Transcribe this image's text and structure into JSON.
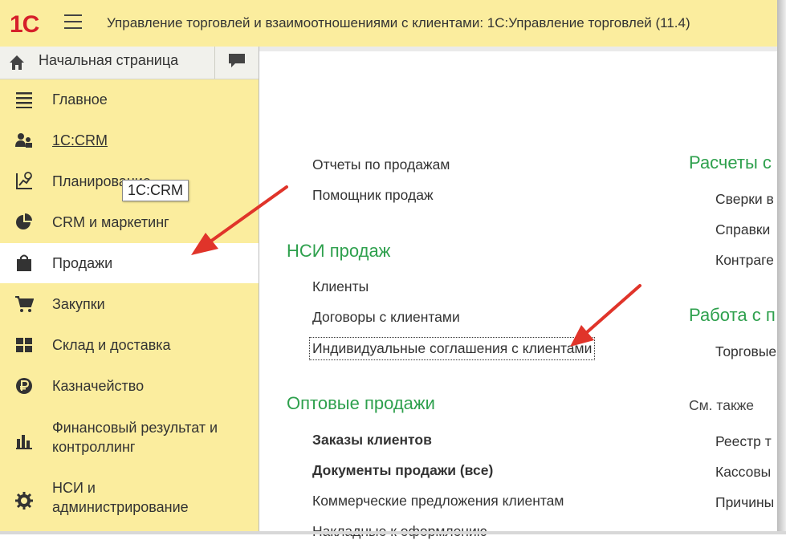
{
  "titlebar": {
    "logo": "1С",
    "title": "Управление торговлей и взаимоотношениями с клиентами: 1С:Управление торговлей (11.4)"
  },
  "home": {
    "label": "Начальная страница"
  },
  "sidebar": {
    "items": [
      {
        "label": "Главное",
        "icon": "list-icon"
      },
      {
        "label": "1C:CRM",
        "icon": "users-icon"
      },
      {
        "label": "Планирование",
        "icon": "planning-icon"
      },
      {
        "label": "CRM и маркетинг",
        "icon": "pie-chart-icon"
      },
      {
        "label": "Продажи",
        "icon": "shopping-bag-icon"
      },
      {
        "label": "Закупки",
        "icon": "cart-icon"
      },
      {
        "label": "Склад и доставка",
        "icon": "warehouse-grid-icon"
      },
      {
        "label": "Казначейство",
        "icon": "ruble-icon"
      },
      {
        "label": "Финансовый результат и\nконтроллинг",
        "line1": "Финансовый результат и",
        "line2": "контроллинг",
        "icon": "bar-chart-icon"
      },
      {
        "label": "НСИ и\nадминистрирование",
        "line1": "НСИ и",
        "line2": "администрирование",
        "icon": "gear-icon"
      }
    ],
    "tooltip": "1C:CRM"
  },
  "main": {
    "col1": {
      "top_links": [
        "Отчеты по продажам",
        "Помощник продаж"
      ],
      "sections": [
        {
          "title": "НСИ продаж",
          "links": [
            "Клиенты",
            "Договоры с клиентами",
            "Индивидуальные соглашения с клиентами"
          ]
        },
        {
          "title": "Оптовые продажи",
          "links": [
            "Заказы клиентов",
            "Документы продажи (все)",
            "Коммерческие предложения клиентам",
            "Накладные к оформлению"
          ]
        }
      ]
    },
    "col2": {
      "sections": [
        {
          "title": "Расчеты с",
          "links": [
            "Сверки в",
            "Справки",
            "Контраге"
          ]
        },
        {
          "title": "Работа с п",
          "links": [
            "Торговые"
          ]
        }
      ],
      "see_also": "См. также",
      "see_also_links": [
        "Реестр т",
        "Кассовы",
        "Причины"
      ]
    }
  },
  "colors": {
    "sidebar_bg": "#fbed9e",
    "section_green": "#2ea04d",
    "arrow_red": "#e0342a",
    "logo_red": "#d6202a"
  }
}
